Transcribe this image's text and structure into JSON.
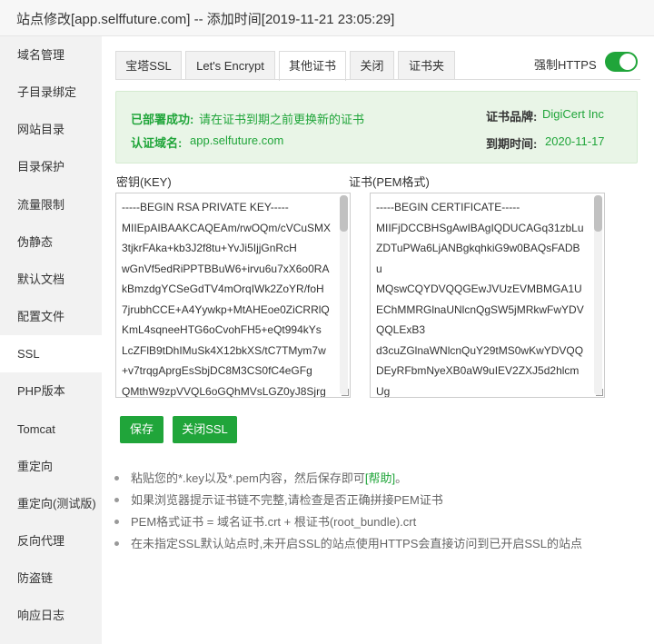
{
  "window": {
    "title": "站点修改[app.selffuture.com] -- 添加时间[2019-11-21 23:05:29]"
  },
  "sidebar": {
    "items": [
      {
        "label": "域名管理"
      },
      {
        "label": "子目录绑定"
      },
      {
        "label": "网站目录"
      },
      {
        "label": "目录保护"
      },
      {
        "label": "流量限制"
      },
      {
        "label": "伪静态"
      },
      {
        "label": "默认文档"
      },
      {
        "label": "配置文件"
      },
      {
        "label": "SSL",
        "active": true
      },
      {
        "label": "PHP版本"
      },
      {
        "label": "Tomcat"
      },
      {
        "label": "重定向"
      },
      {
        "label": "重定向(测试版)"
      },
      {
        "label": "反向代理"
      },
      {
        "label": "防盗链"
      },
      {
        "label": "响应日志"
      }
    ]
  },
  "tabs": [
    {
      "label": "宝塔SSL"
    },
    {
      "label": "Let's Encrypt"
    },
    {
      "label": "其他证书",
      "active": true
    },
    {
      "label": "关闭"
    },
    {
      "label": "证书夹"
    }
  ],
  "https_toggle": {
    "label": "强制HTTPS",
    "on": true
  },
  "info": {
    "status_label": "已部署成功:",
    "status_text": "请在证书到期之前更换新的证书",
    "domain_label": "认证域名:",
    "domain_value": "app.selfuture.com",
    "brand_label": "证书品牌:",
    "brand_value": "DigiCert Inc",
    "expiry_label": "到期时间:",
    "expiry_value": "2020-11-17"
  },
  "key_field": {
    "title": "密钥(KEY)",
    "lines": [
      "-----BEGIN RSA PRIVATE KEY-----",
      "MIIEpAIBAAKCAQEAm/rwOQm/cVCuSMX",
      "3tjkrFAka+kb3J2f8tu+YvJi5IjjGnRcH",
      "wGnVf5edRiPPTBBuW6+irvu6u7xX6o0RA",
      "kBmzdgYCSeGdTV4mOrqIWk2ZoYR/foH",
      "7jrubhCCE+A4Yywkp+MtAHEoe0ZiCRRlQ",
      "KmL4sqneeHTG6oCvohFH5+eQt994kYs",
      "LcZFlB9tDhIMuSk4X12bkXS/tC7TMym7w",
      "+v7trqgAprgEsSbjDC8M3CS0fC4eGFg",
      "QMthW9zpVVQL6oGQhMVsLGZ0yJ8Sjrg"
    ]
  },
  "cert_field": {
    "title": "证书(PEM格式)",
    "lines": [
      "-----BEGIN CERTIFICATE-----",
      "MIIFjDCCBHSgAwIBAgIQDUCAGq31zbLu",
      "ZDTuPWa6LjANBgkqhkiG9w0BAQsFADB",
      "u",
      "MQswCQYDVQQGEwJVUzEVMBMGA1U",
      "EChMMRGlnaUNlcnQgSW5jMRkwFwYDV",
      "QQLExB3",
      "d3cuZGlnaWNlcnQuY29tMS0wKwYDVQQ",
      "DEyRFbmNyeXB0aW9uIEV2ZXJ5d2hlcm",
      "Ug"
    ]
  },
  "buttons": {
    "save": "保存",
    "close_ssl": "关闭SSL"
  },
  "tips": [
    {
      "text": "粘贴您的*.key以及*.pem内容，然后保存即可",
      "help": "[帮助]",
      "tail": "。"
    },
    {
      "text": "如果浏览器提示证书链不完整,请检查是否正确拼接PEM证书"
    },
    {
      "text": "PEM格式证书 = 域名证书.crt + 根证书(root_bundle).crt"
    },
    {
      "text": "在未指定SSL默认站点时,未开启SSL的站点使用HTTPS会直接访问到已开启SSL的站点"
    }
  ],
  "colors": {
    "accent": "#20a53a",
    "sidebar_bg": "#f2f2f2",
    "info_bg": "#e9f5e7"
  }
}
